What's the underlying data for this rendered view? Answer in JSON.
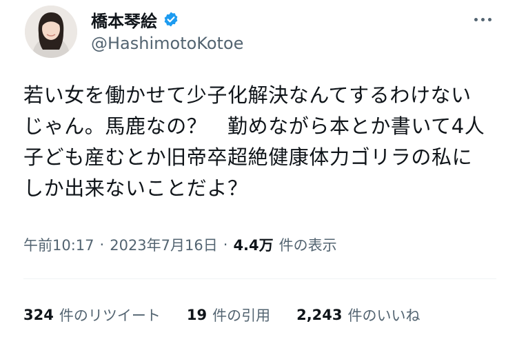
{
  "user": {
    "display_name": "橋本琴絵",
    "handle": "@HashimotoKotoe",
    "verified_icon": "verified-badge-icon",
    "verified_color": "#1d9bf0"
  },
  "tweet": {
    "text": "若い女を働かせて少子化解決なんてするわけない\nじゃん。馬鹿なの？　勤めながら本とか書いて4人\n子ども産むとか旧帝卒超絶健康体力ゴリラの私に\nしか出来ないことだよ？",
    "time": "午前10:17",
    "separator": "·",
    "date": "2023年7月16日",
    "views_count": "4.4万",
    "views_label": "件の表示"
  },
  "stats": {
    "retweets_count": "324",
    "retweets_label": "件のリツイート",
    "quotes_count": "19",
    "quotes_label": "件の引用",
    "likes_count": "2,243",
    "likes_label": "件のいいね"
  },
  "menu": {
    "icon": "more-options-icon"
  },
  "colors": {
    "text": "#0f1419",
    "secondary": "#536471",
    "divider": "#eff3f4"
  }
}
